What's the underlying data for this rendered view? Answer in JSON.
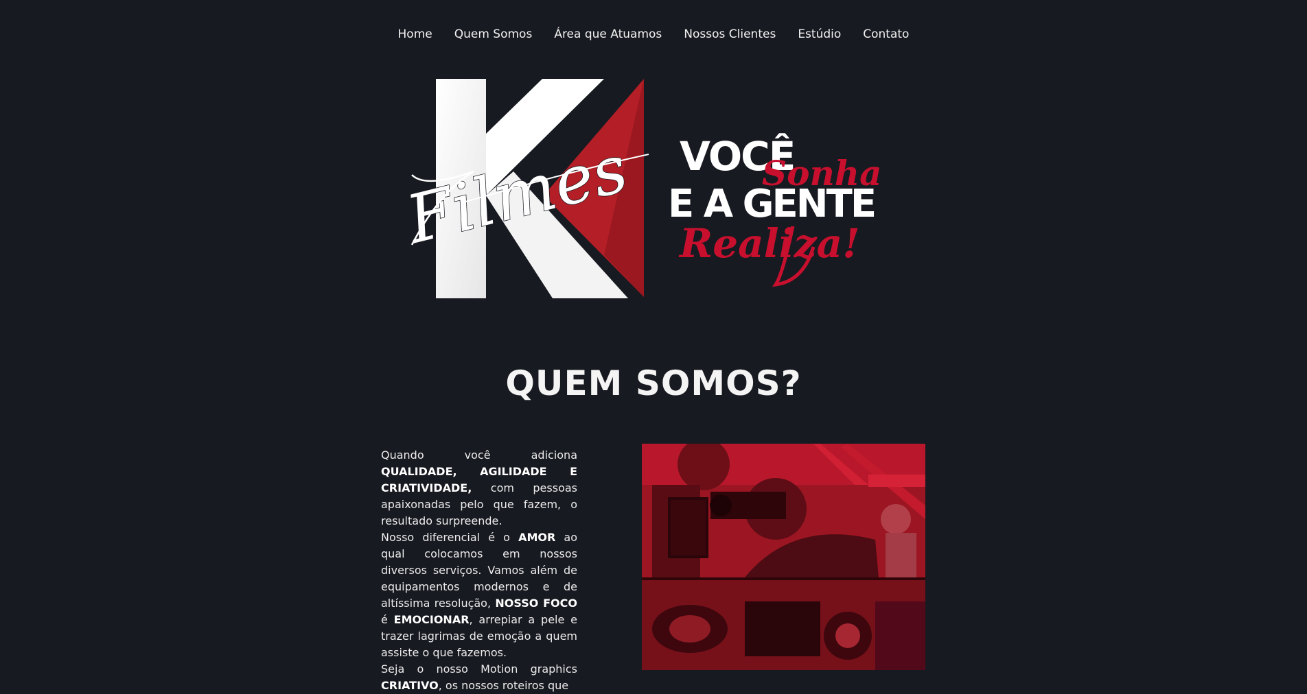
{
  "nav": {
    "items": [
      {
        "label": "Home"
      },
      {
        "label": "Quem Somos"
      },
      {
        "label": "Área que Atuamos"
      },
      {
        "label": "Nossos Clientes"
      },
      {
        "label": "Estúdio"
      },
      {
        "label": "Contato"
      }
    ]
  },
  "logo": {
    "script_text": "Filmes"
  },
  "slogan": {
    "line1": "VOCÊ",
    "script1": "Sonha",
    "line2": "E A GENTE",
    "script2": "Realiza!"
  },
  "about": {
    "title": "QUEM SOMOS?",
    "p1_a": "Quando você adiciona ",
    "p1_b": "QUALIDADE, AGILIDADE E CRIATIVIDADE,",
    "p1_c": " com pessoas apaixonadas pelo que fazem, o resultado surpreende.",
    "p2_a": "Nosso diferencial é o ",
    "p2_b": "AMOR",
    "p2_c": " ao qual colocamos em nossos diversos serviços. Vamos além de equipamentos modernos e de altíssima resolução, ",
    "p2_d": "NOSSO FOCO",
    "p2_e": " é ",
    "p2_f": "EMOCIONAR",
    "p2_g": ", arrepiar a pele e trazer lagrimas de emoção a quem assiste o que fazemos.",
    "p3_a": "Seja o nosso Motion graphics ",
    "p3_b": "CRIATIVO",
    "p3_c": ", os nossos roteiros que"
  },
  "colors": {
    "background": "#181a21",
    "brand_red": "#c8102e",
    "white": "#ffffff"
  }
}
